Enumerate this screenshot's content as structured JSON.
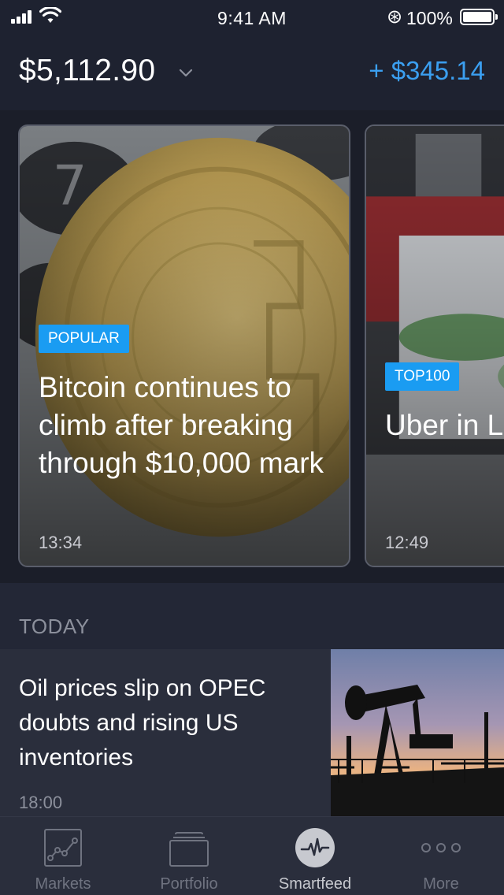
{
  "status_bar": {
    "time": "9:41 AM",
    "battery_percent": "100%",
    "icons": [
      "signal-icon",
      "wifi-icon",
      "bluetooth-icon",
      "battery-icon"
    ]
  },
  "header": {
    "balance": "$5,112.90",
    "change": "+ $345.14",
    "change_color": "#3b9ff0"
  },
  "featured": [
    {
      "tag": "POPULAR",
      "title": "Bitcoin continues to climb after breaking through $10,000 mark",
      "time": "13:34"
    },
    {
      "tag": "TOP100",
      "title": "Uber in London war about immigrat",
      "time": "12:49"
    }
  ],
  "today": {
    "label": "TODAY",
    "items": [
      {
        "title": "Oil prices slip on OPEC doubts and rising US inventories",
        "time": "18:00"
      }
    ]
  },
  "tabbar": {
    "tabs": [
      {
        "label": "Markets",
        "icon": "chart-icon",
        "active": false
      },
      {
        "label": "Portfolio",
        "icon": "briefcase-icon",
        "active": false
      },
      {
        "label": "Smartfeed",
        "icon": "pulse-icon",
        "active": true
      },
      {
        "label": "More",
        "icon": "more-dots-icon",
        "active": false
      }
    ]
  },
  "colors": {
    "accent": "#1a9cf2",
    "background": "#232736"
  }
}
